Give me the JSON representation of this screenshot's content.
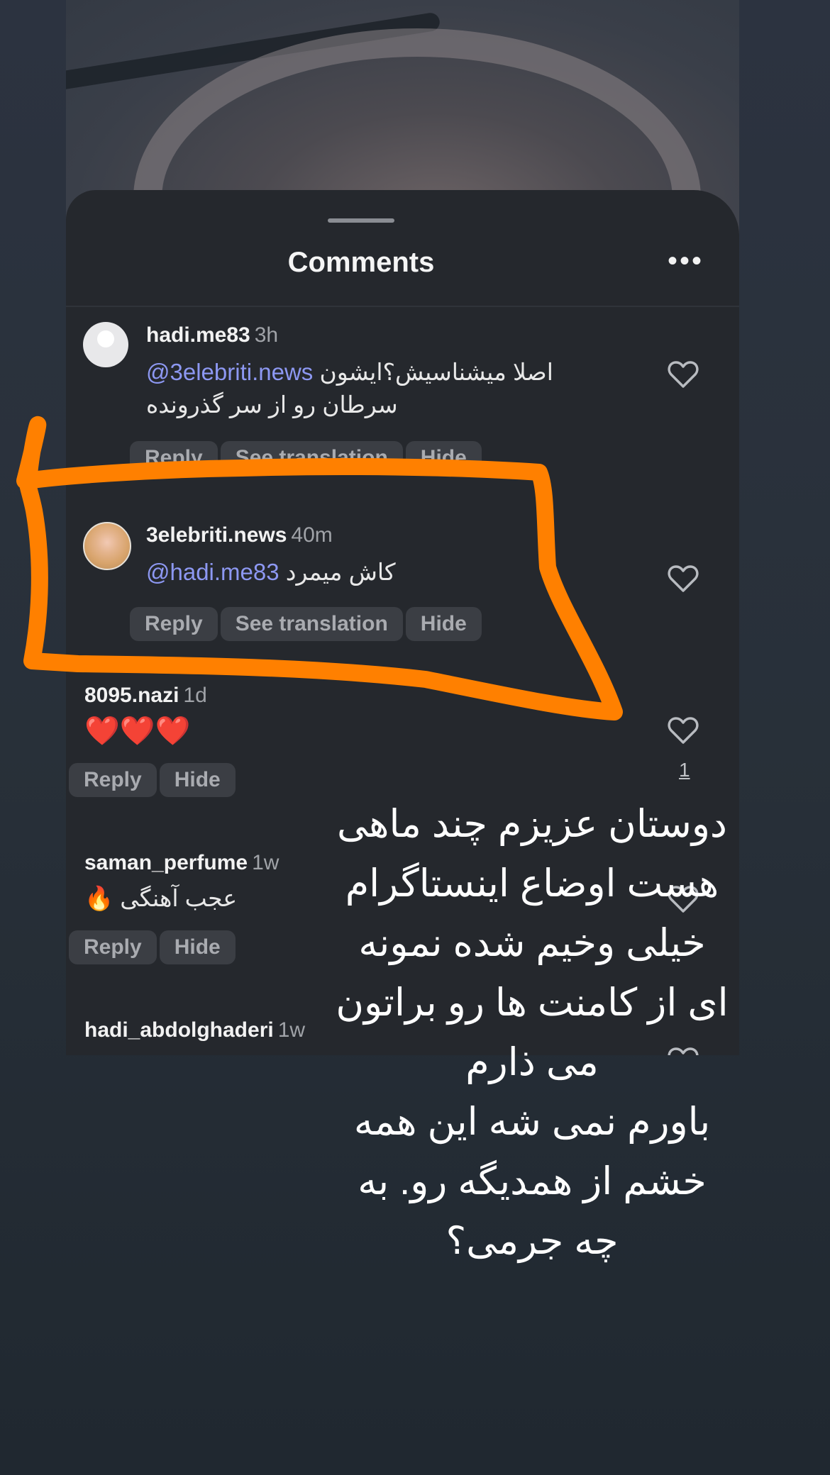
{
  "sheet": {
    "title": "Comments"
  },
  "comments": [
    {
      "username": "hadi.me83",
      "time": "3h",
      "mention": "@3elebriti.news",
      "text_line1": "اصلا میشناسیش؟ایشون",
      "text_line2": "سرطان رو از سر گذرونده",
      "actions": [
        "Reply",
        "See translation",
        "Hide"
      ]
    },
    {
      "username": "3elebriti.news",
      "time": "40m",
      "mention": "@hadi.me83",
      "text_line1": "کاش میمرد",
      "actions": [
        "Reply",
        "See translation",
        "Hide"
      ]
    },
    {
      "username": "8095.nazi",
      "time": "1d",
      "text_line1": "❤️❤️❤️",
      "actions": [
        "Reply",
        "Hide"
      ],
      "likes": "1"
    },
    {
      "username": "saman_perfume",
      "time": "1w",
      "text_line1": "عجب آهنگی 🔥",
      "actions": [
        "Reply",
        "Hide"
      ]
    },
    {
      "username": "hadi_abdolghaderi",
      "time": "1w"
    }
  ],
  "overlay": {
    "lines": [
      "دوستان عزیزم چند ماهی",
      "هست اوضاع اینستاگرام",
      "خیلی وخیم شده نمونه",
      "ای از کامنت ها رو براتون",
      "می ذارم",
      "باورم نمی شه این همه",
      "خشم از همدیگه رو. به",
      "چه جرمی؟"
    ]
  },
  "colors": {
    "highlight": "#ff8000",
    "mention": "#8d98f2"
  },
  "icons": {
    "like": "heart-outline-icon",
    "more": "more-horizontal-icon"
  }
}
